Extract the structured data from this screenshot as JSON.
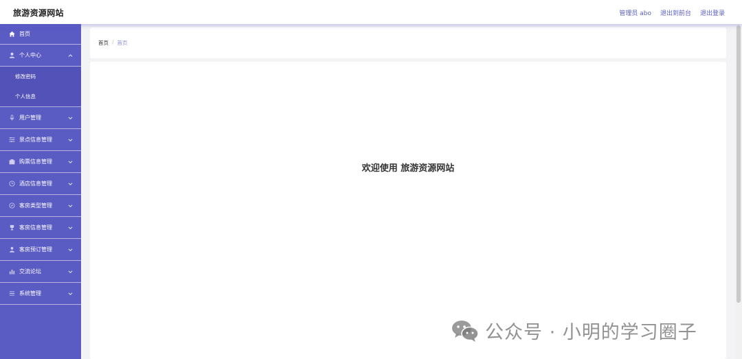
{
  "header": {
    "brand": "旅游资源网站",
    "admin_label": "管理员 abo",
    "to_frontend": "退出到前台",
    "logout": "退出登录"
  },
  "sidebar": {
    "items": [
      {
        "label": "首页",
        "icon": "home-icon"
      },
      {
        "label": "个人中心",
        "icon": "user-icon",
        "expanded": true,
        "children": [
          {
            "label": "修改密码"
          },
          {
            "label": "个人信息"
          }
        ]
      },
      {
        "label": "用户管理",
        "icon": "microphone-icon"
      },
      {
        "label": "景点信息管理",
        "icon": "sliders-icon"
      },
      {
        "label": "购票信息管理",
        "icon": "ticket-icon"
      },
      {
        "label": "酒店信息管理",
        "icon": "clock-icon"
      },
      {
        "label": "客房类型管理",
        "icon": "compass-icon"
      },
      {
        "label": "客房信息管理",
        "icon": "trophy-icon"
      },
      {
        "label": "客房预订管理",
        "icon": "person-icon"
      },
      {
        "label": "交流论坛",
        "icon": "bar-chart-icon"
      },
      {
        "label": "系统管理",
        "icon": "menu-icon"
      }
    ]
  },
  "breadcrumb": {
    "home": "首页",
    "separator": "/",
    "current": "首页"
  },
  "main": {
    "welcome": "欢迎使用 旅游资源网站"
  },
  "watermark": {
    "text": "公众号 · 小明的学习圈子",
    "icon": "wechat-icon"
  },
  "colors": {
    "sidebar": "#5b5bc4",
    "accent": "#5a5cc4",
    "background": "#f3f3f5"
  }
}
